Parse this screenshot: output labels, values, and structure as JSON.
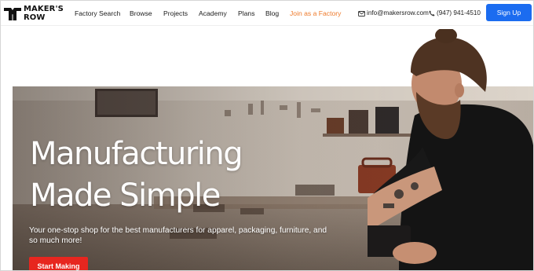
{
  "brand": {
    "line1": "MAKER'S",
    "line2": "ROW"
  },
  "nav": {
    "items": [
      {
        "label": "Factory Search"
      },
      {
        "label": "Browse"
      },
      {
        "label": "Projects"
      },
      {
        "label": "Academy"
      },
      {
        "label": "Plans"
      },
      {
        "label": "Blog"
      },
      {
        "label": "Join as a Factory"
      }
    ]
  },
  "contact": {
    "email": "info@makersrow.com",
    "phone": "(947) 941-4510"
  },
  "signup": {
    "label": "Sign Up"
  },
  "hero": {
    "title_line1": "Manufacturing",
    "title_line2": "Made Simple",
    "subtitle": "Your one-stop shop for the best manufacturers for apparel, packaging, furniture, and so much more!",
    "cta_label": "Start Making"
  },
  "icons": {
    "email": "email-icon",
    "phone": "phone-icon"
  },
  "colors": {
    "accent": "#ee7a2b",
    "primary": "#1b6cf0",
    "cta": "#e7261f"
  }
}
